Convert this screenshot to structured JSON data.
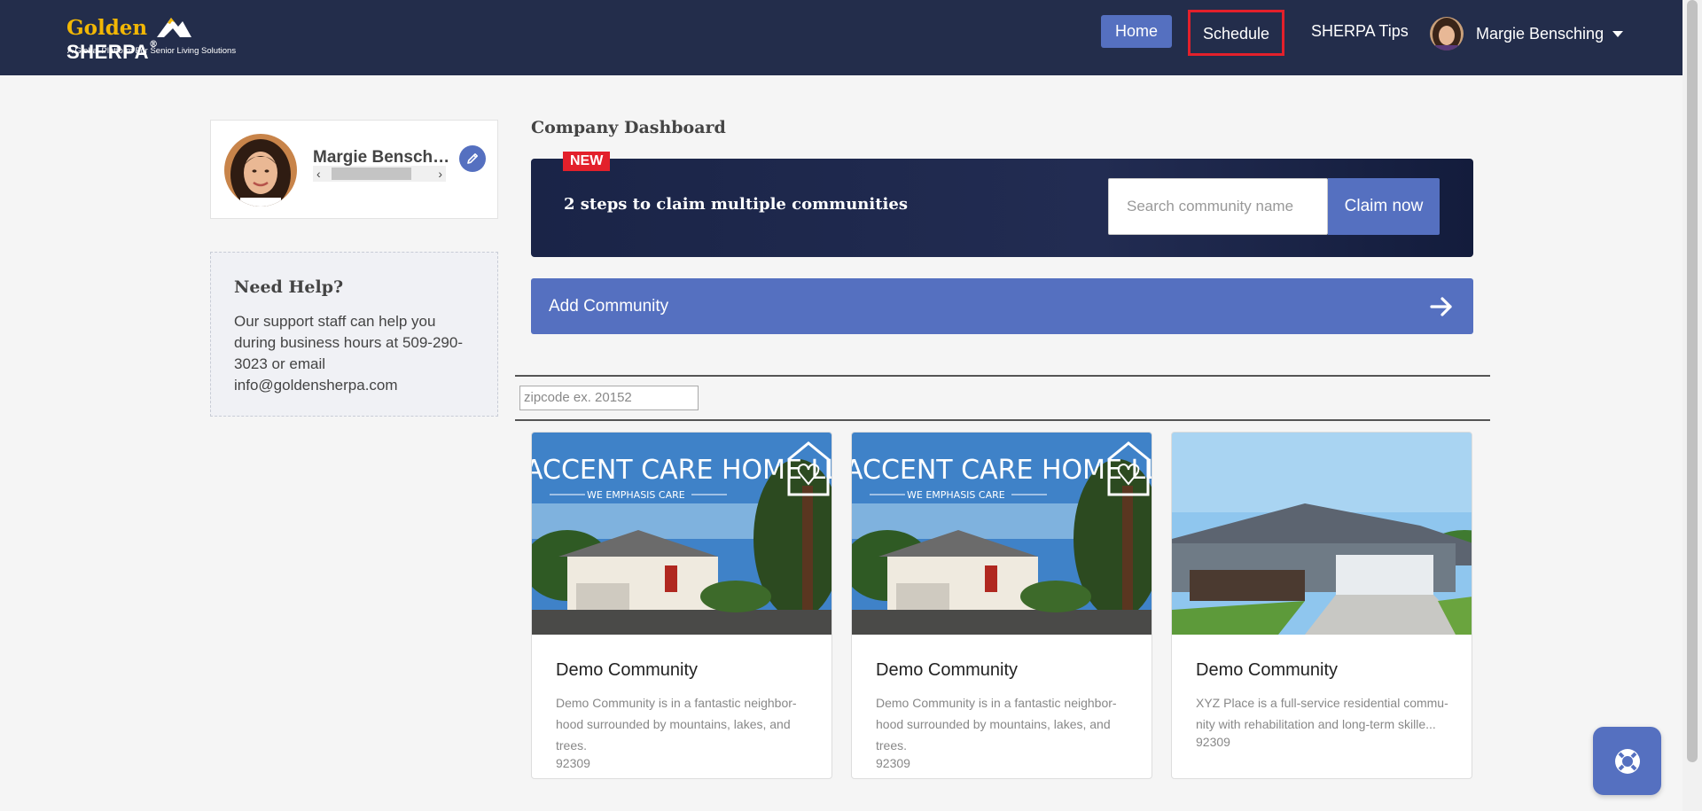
{
  "header": {
    "logo": {
      "golden": "Golden",
      "sherpa": "SHERPA",
      "tm": "®",
      "tagline": "A Global Platform For Senior Living Solutions"
    },
    "nav": {
      "home": "Home",
      "schedule": "Schedule",
      "tips": "SHERPA Tips"
    },
    "user_name": "Margie Bensching"
  },
  "profile": {
    "name": "Margie Bensching"
  },
  "help": {
    "title": "Need Help?",
    "text": "Our support staff can help you during business hours at 509-290-3023 or email info@goldensherpa.com"
  },
  "dashboard": {
    "title": "Company Dashboard",
    "banner": {
      "badge": "NEW",
      "text": "2 steps to claim multiple communities",
      "search_placeholder": "Search community name",
      "claim_label": "Claim now"
    },
    "add_community": "Add Community",
    "zip_placeholder": "zipcode ex. 20152"
  },
  "communities": [
    {
      "title": "Demo Community",
      "description": "Demo Community is in a fantastic neighbor-hood surrounded by mountains, lakes, and trees.",
      "zip": "92309",
      "image_banner": "ACCENT CARE HOME LLC",
      "image_sub": "WE EMPHASIS CARE"
    },
    {
      "title": "Demo Community",
      "description": "Demo Community is in a fantastic neighbor-hood surrounded by mountains, lakes, and trees.",
      "zip": "92309",
      "image_banner": "ACCENT CARE HOME LLC",
      "image_sub": "WE EMPHASIS CARE"
    },
    {
      "title": "Demo Community",
      "description": "XYZ Place is a full-service residential commu-nity with rehabilitation and long-term skille...",
      "zip": "92309"
    }
  ],
  "colors": {
    "header_bg": "#232d4b",
    "accent": "#5570c0",
    "highlight": "#e3202b",
    "page_bg": "#f5f5f5"
  },
  "icons": [
    "mountain-logo-icon",
    "caret-down-icon",
    "pencil-icon",
    "chevron-left-icon",
    "chevron-right-icon",
    "arrow-right-icon",
    "lifebuoy-icon"
  ]
}
